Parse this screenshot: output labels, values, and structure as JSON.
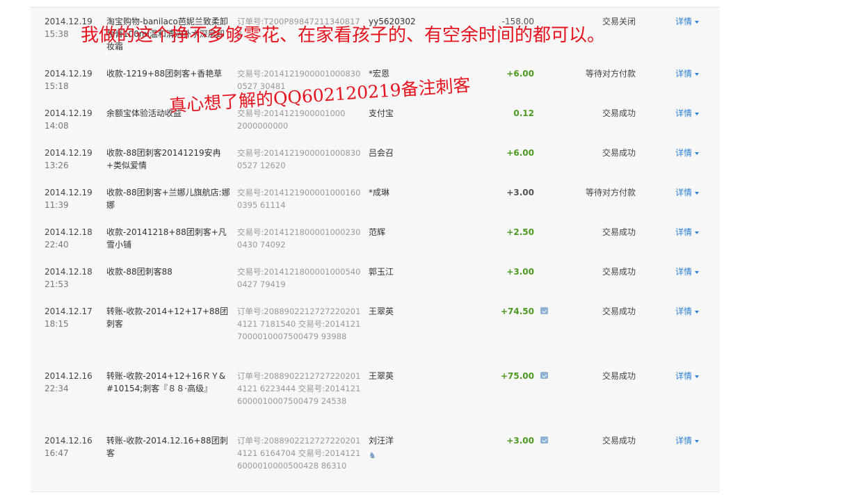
{
  "rows": [
    {
      "date": "2014.12.19",
      "time": "15:38",
      "name": "淘宝购物-banilaco芭妮兰致柔卸妆膏100ml温和清洁补水深层卸妆霜",
      "order": "订单号:T200P898472113408173\n交易号:2014121921001001220044",
      "party": "yy5620302",
      "amount": "-158.00",
      "status": "交易关闭",
      "detail": "详情"
    },
    {
      "date": "2014.12.19",
      "time": "15:18",
      "name": "收款-1219+88团刺客+香艳草",
      "order": "交易号:20141219000010008300527 30481",
      "party": "*宏恩",
      "amount": "+6.00",
      "status": "等待对方付款",
      "detail": "详情"
    },
    {
      "date": "2014.12.19",
      "time": "14:08",
      "name": "余额宝体验活动收益",
      "order": "交易号:2014121900001000\n2000000000",
      "party": "支付宝",
      "amount": "0.12",
      "status": "交易成功",
      "detail": "详情"
    },
    {
      "date": "2014.12.19",
      "time": "13:26",
      "name": "收款-88团刺客20141219安冉+类似爱情",
      "order": "交易号:20141219000010008300527 12620",
      "party": "吕会召",
      "amount": "+6.00",
      "status": "交易成功",
      "detail": "详情"
    },
    {
      "date": "2014.12.19",
      "time": "11:39",
      "name": "收款-88团刺客+兰娜儿旗航店:娜娜",
      "order": "交易号:20141219000010001600395 61114",
      "party": "*成琳",
      "amount": "+3.00",
      "status": "等待对方付款",
      "detail": "详情"
    },
    {
      "date": "2014.12.18",
      "time": "22:40",
      "name": "收款-20141218+88团刺客+凡雪小铺",
      "order": "交易号:20141218000010002300430 74092",
      "party": "范辉",
      "amount": "+2.50",
      "status": "交易成功",
      "detail": "详情"
    },
    {
      "date": "2014.12.18",
      "time": "21:53",
      "name": "收款-88团刺客88",
      "order": "交易号:20141218000010005400427 79419",
      "party": "郭玉江",
      "amount": "+3.00",
      "status": "交易成功",
      "detail": "详情"
    },
    {
      "date": "2014.12.17",
      "time": "18:15",
      "name": "转账-收款-2014+12+17+88团刺客",
      "order": "订单号:20889022127272202014121 7181540 交易号:20141217000010007500479 93988",
      "party": "王翠英",
      "amount": "+74.50",
      "status": "交易成功",
      "detail": "详情"
    },
    {
      "date": "2014.12.16",
      "time": "22:34",
      "name": "转账-收款-2014+12+16ＲＹ&#10154;刺客『８８·高级』",
      "order": "订单号:20889022127272202014121 6223444 交易号:20141216000010007500479 24538",
      "party": "王翠英",
      "amount": "+75.00",
      "status": "交易成功",
      "detail": "详情"
    },
    {
      "date": "2014.12.16",
      "time": "16:47",
      "name": "转账-收款-2014.12.16+88团刺客",
      "order": "订单号:20889022127272202014121 6164704 交易号:20141216000010000500428 86310",
      "party": "刘汪洋",
      "amount": "+3.00",
      "status": "交易成功",
      "detail": "详情"
    }
  ],
  "overlay": {
    "line1": "我做的这个挣不多够零花、在家看孩子的、有空余时间的都可以。",
    "line2": "真心想了解的QQ602120219备注刺客"
  }
}
